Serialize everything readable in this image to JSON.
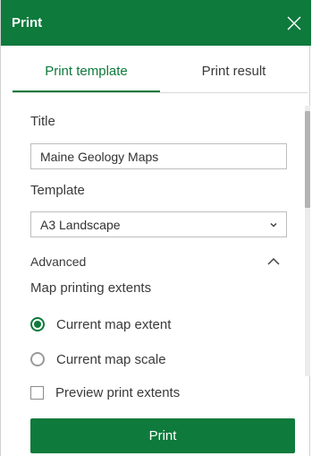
{
  "header": {
    "title": "Print",
    "close_icon": "close-icon"
  },
  "tabs": [
    {
      "label": "Print template",
      "active": true
    },
    {
      "label": "Print result",
      "active": false
    }
  ],
  "form": {
    "title_label": "Title",
    "title_value": "Maine Geology Maps",
    "template_label": "Template",
    "template_value": "A3 Landscape",
    "advanced_label": "Advanced",
    "extents_label": "Map printing extents",
    "options": [
      {
        "label": "Current map extent",
        "selected": true
      },
      {
        "label": "Current map scale",
        "selected": false
      }
    ],
    "preview_label": "Preview print extents",
    "preview_checked": false
  },
  "print_button": "Print",
  "colors": {
    "accent": "#0e7a3c",
    "text": "#3a3a3a",
    "border": "#bdbdbd"
  }
}
